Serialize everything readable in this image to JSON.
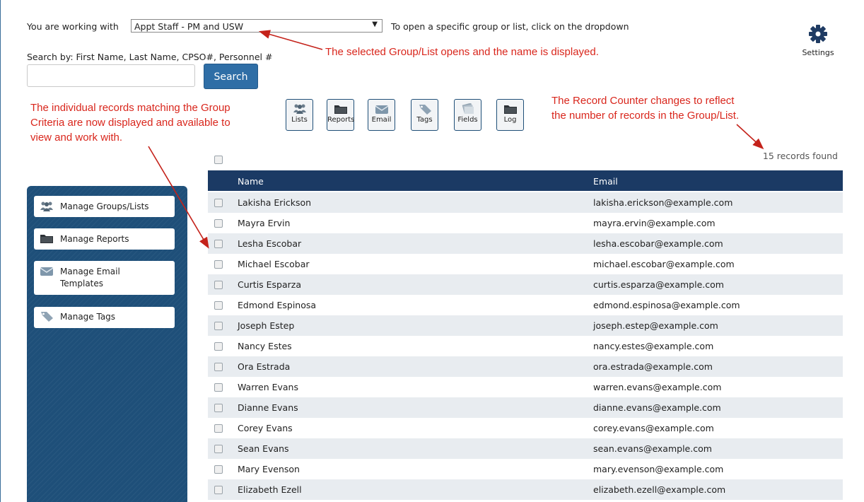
{
  "header": {
    "working_with_label": "You are working with",
    "selected_group": "Appt Staff - PM and USW",
    "dropdown_hint": "To open a specific group or list, click on the dropdown",
    "search_label": "Search by: First Name, Last Name, CPSO#, Personnel #",
    "search_value": "",
    "search_button": "Search",
    "settings_label": "Settings"
  },
  "toolbar": [
    {
      "label": "Lists",
      "icon": "people-icon"
    },
    {
      "label": "Reports",
      "icon": "folder-icon"
    },
    {
      "label": "Email",
      "icon": "envelope-icon"
    },
    {
      "label": "Tags",
      "icon": "tag-icon"
    },
    {
      "label": "Fields",
      "icon": "documents-icon"
    },
    {
      "label": "Log",
      "icon": "folder-icon"
    }
  ],
  "record_count": "15 records found",
  "sidebar": {
    "items": [
      {
        "label": "Manage Groups/Lists",
        "icon": "people-icon"
      },
      {
        "label": "Manage Reports",
        "icon": "folder-icon"
      },
      {
        "label_line1": "Manage Email",
        "label_line2": "Templates",
        "icon": "envelope-icon"
      },
      {
        "label": "Manage Tags",
        "icon": "tag-icon"
      }
    ]
  },
  "table": {
    "columns": [
      "Name",
      "Email"
    ],
    "rows": [
      {
        "name": "Lakisha Erickson",
        "email": "lakisha.erickson@example.com"
      },
      {
        "name": "Mayra Ervin",
        "email": "mayra.ervin@example.com"
      },
      {
        "name": "Lesha Escobar",
        "email": "lesha.escobar@example.com"
      },
      {
        "name": "Michael Escobar",
        "email": "michael.escobar@example.com"
      },
      {
        "name": "Curtis Esparza",
        "email": "curtis.esparza@example.com"
      },
      {
        "name": "Edmond Espinosa",
        "email": "edmond.espinosa@example.com"
      },
      {
        "name": "Joseph Estep",
        "email": "joseph.estep@example.com"
      },
      {
        "name": "Nancy Estes",
        "email": "nancy.estes@example.com"
      },
      {
        "name": "Ora Estrada",
        "email": "ora.estrada@example.com"
      },
      {
        "name": "Warren Evans",
        "email": "warren.evans@example.com"
      },
      {
        "name": "Dianne Evans",
        "email": "dianne.evans@example.com"
      },
      {
        "name": "Corey Evans",
        "email": "corey.evans@example.com"
      },
      {
        "name": "Sean Evans",
        "email": "sean.evans@example.com"
      },
      {
        "name": "Mary Evenson",
        "email": "mary.evenson@example.com"
      },
      {
        "name": "Elizabeth Ezell",
        "email": "elizabeth.ezell@example.com"
      }
    ]
  },
  "annotations": {
    "group_opened": "The selected Group/List opens and the name is displayed.",
    "records_line1": "The individual records matching the Group",
    "records_line2": "Criteria are now displayed and available to",
    "records_line3": "view and work with.",
    "counter_line1": "The Record Counter changes to reflect",
    "counter_line2": "the number of records in the Group/List."
  },
  "colors": {
    "annotation_red": "#d9261c",
    "header_navy": "#1b3a64",
    "sidebar_blue": "#1e4f79",
    "search_button_blue": "#2f6ea6"
  }
}
